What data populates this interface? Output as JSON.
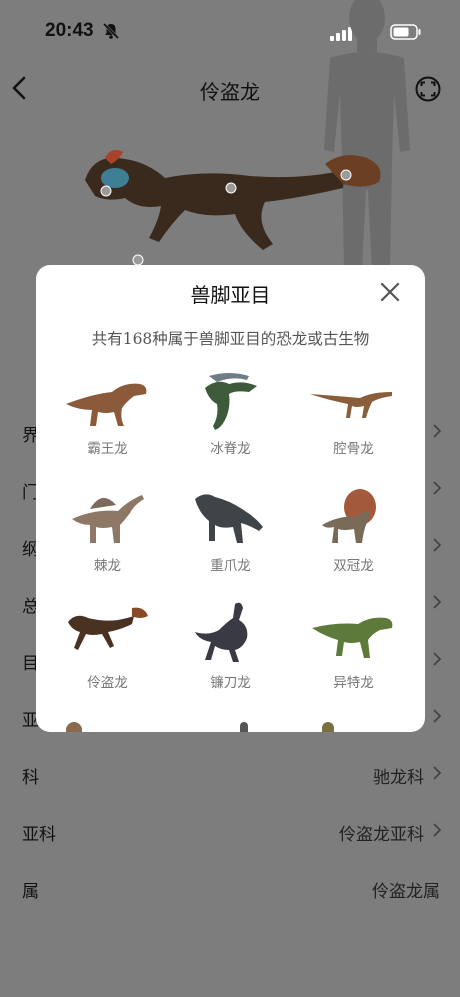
{
  "status_bar": {
    "time": "20:43",
    "icons": [
      "mute-icon",
      "cellular-signal-icon",
      "wifi-icon",
      "battery-icon"
    ]
  },
  "header": {
    "title": "伶盗龙",
    "back_icon": "chevron-left-icon",
    "fullscreen_icon": "expand-corners-icon"
  },
  "colors": {
    "overlay_background": "#7d7d7d",
    "modal_background": "#ffffff",
    "subtle_text": "#777777"
  },
  "modal": {
    "title": "兽脚亚目",
    "subtitle": "共有168种属于兽脚亚目的恐龙或古生物",
    "close_icon": "close-icon",
    "items": [
      {
        "name": "霸王龙"
      },
      {
        "name": "冰脊龙"
      },
      {
        "name": "腔骨龙"
      },
      {
        "name": "棘龙"
      },
      {
        "name": "重爪龙"
      },
      {
        "name": "双冠龙"
      },
      {
        "name": "伶盗龙"
      },
      {
        "name": "镰刀龙"
      },
      {
        "name": "异特龙"
      }
    ]
  },
  "taxonomy": {
    "rows": [
      {
        "label": "界",
        "value": ""
      },
      {
        "label": "门",
        "value": ""
      },
      {
        "label": "纲",
        "value": ""
      },
      {
        "label": "总",
        "value": ""
      },
      {
        "label": "目",
        "value": ""
      },
      {
        "label": "亚",
        "value": ""
      },
      {
        "label": "科",
        "value": "驰龙科"
      },
      {
        "label": "亚科",
        "value": "伶盗龙亚科"
      },
      {
        "label": "属",
        "value": "伶盗龙属"
      }
    ]
  }
}
